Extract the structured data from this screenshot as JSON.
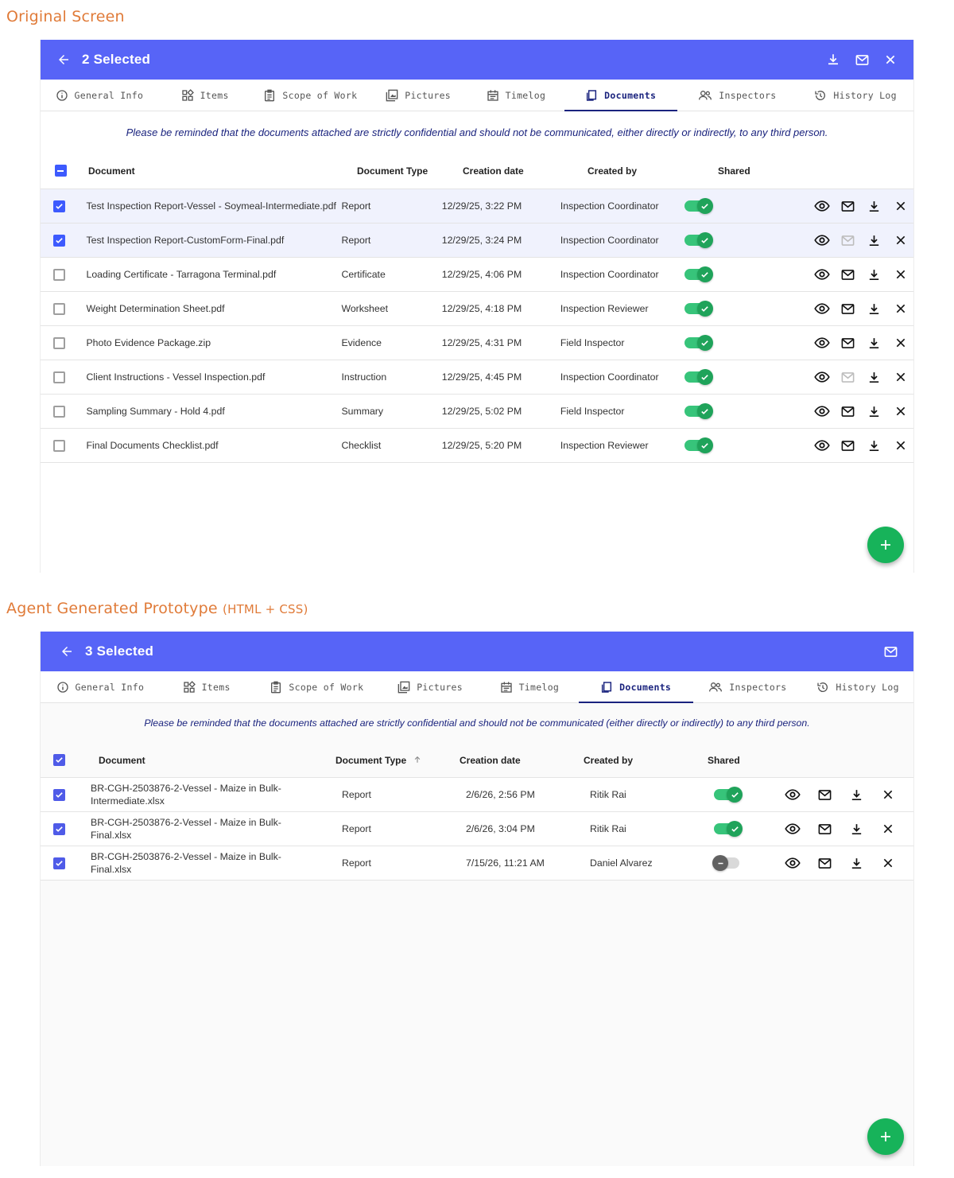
{
  "captions": {
    "original": "Original Screen",
    "prototype_main": "Agent Generated Prototype",
    "prototype_suffix": "(HTML + CSS)"
  },
  "tabs": [
    {
      "label": "General Info",
      "icon": "info-icon"
    },
    {
      "label": "Items",
      "icon": "items-grid-icon"
    },
    {
      "label": "Scope of Work",
      "icon": "clipboard-icon"
    },
    {
      "label": "Pictures",
      "icon": "gallery-icon"
    },
    {
      "label": "Timelog",
      "icon": "calendar-icon"
    },
    {
      "label": "Documents",
      "icon": "documents-icon"
    },
    {
      "label": "Inspectors",
      "icon": "people-icon"
    },
    {
      "label": "History Log",
      "icon": "history-icon"
    }
  ],
  "columns": {
    "document": "Document",
    "type": "Document Type",
    "date": "Creation date",
    "by": "Created by",
    "shared": "Shared"
  },
  "colors": {
    "header": "#5764f7",
    "accent": "#1a237e",
    "toggle_on": "#1fa35a",
    "fab": "#17b35a"
  },
  "original": {
    "selected_label": "2 Selected",
    "notice": "Please be reminded that the documents attached are strictly confidential and should not be communicated, either directly or indirectly, to any third person.",
    "header_checkbox": "indeterminate",
    "rows": [
      {
        "checked": true,
        "name": "Test Inspection Report-Vessel - Soymeal-Intermediate.pdf",
        "type": "Report",
        "date": "12/29/25, 3:22 PM",
        "by": "Inspection Coordinator",
        "shared": true,
        "mail_enabled": true
      },
      {
        "checked": true,
        "name": "Test Inspection Report-CustomForm-Final.pdf",
        "type": "Report",
        "date": "12/29/25, 3:24 PM",
        "by": "Inspection Coordinator",
        "shared": true,
        "mail_enabled": false
      },
      {
        "checked": false,
        "name": "Loading Certificate - Tarragona Terminal.pdf",
        "type": "Certificate",
        "date": "12/29/25, 4:06 PM",
        "by": "Inspection Coordinator",
        "shared": true,
        "mail_enabled": true
      },
      {
        "checked": false,
        "name": "Weight Determination Sheet.pdf",
        "type": "Worksheet",
        "date": "12/29/25, 4:18 PM",
        "by": "Inspection Reviewer",
        "shared": true,
        "mail_enabled": true
      },
      {
        "checked": false,
        "name": "Photo Evidence Package.zip",
        "type": "Evidence",
        "date": "12/29/25, 4:31 PM",
        "by": "Field Inspector",
        "shared": true,
        "mail_enabled": true
      },
      {
        "checked": false,
        "name": "Client Instructions - Vessel Inspection.pdf",
        "type": "Instruction",
        "date": "12/29/25, 4:45 PM",
        "by": "Inspection Coordinator",
        "shared": true,
        "mail_enabled": false
      },
      {
        "checked": false,
        "name": "Sampling Summary - Hold 4.pdf",
        "type": "Summary",
        "date": "12/29/25, 5:02 PM",
        "by": "Field Inspector",
        "shared": true,
        "mail_enabled": true
      },
      {
        "checked": false,
        "name": "Final Documents Checklist.pdf",
        "type": "Checklist",
        "date": "12/29/25, 5:20 PM",
        "by": "Inspection Reviewer",
        "shared": true,
        "mail_enabled": true
      }
    ]
  },
  "prototype": {
    "selected_label": "3 Selected",
    "notice": "Please be reminded that the documents attached are strictly confidential and should not be communicated (either directly or indirectly) to any third person.",
    "header_checkbox": "checked",
    "rows": [
      {
        "checked": true,
        "name": "BR-CGH-2503876-2-Vessel - Maize in Bulk-Intermediate.xlsx",
        "type": "Report",
        "date": "2/6/26, 2:56 PM",
        "by": "Ritik Rai",
        "shared": true,
        "mail_enabled": true
      },
      {
        "checked": true,
        "name": "BR-CGH-2503876-2-Vessel - Maize in Bulk-Final.xlsx",
        "type": "Report",
        "date": "2/6/26, 3:04 PM",
        "by": "Ritik Rai",
        "shared": true,
        "mail_enabled": true
      },
      {
        "checked": true,
        "name": "BR-CGH-2503876-2-Vessel - Maize in Bulk-Final.xlsx",
        "type": "Report",
        "date": "7/15/26, 11:21 AM",
        "by": "Daniel Alvarez",
        "shared": false,
        "mail_enabled": true
      }
    ]
  }
}
